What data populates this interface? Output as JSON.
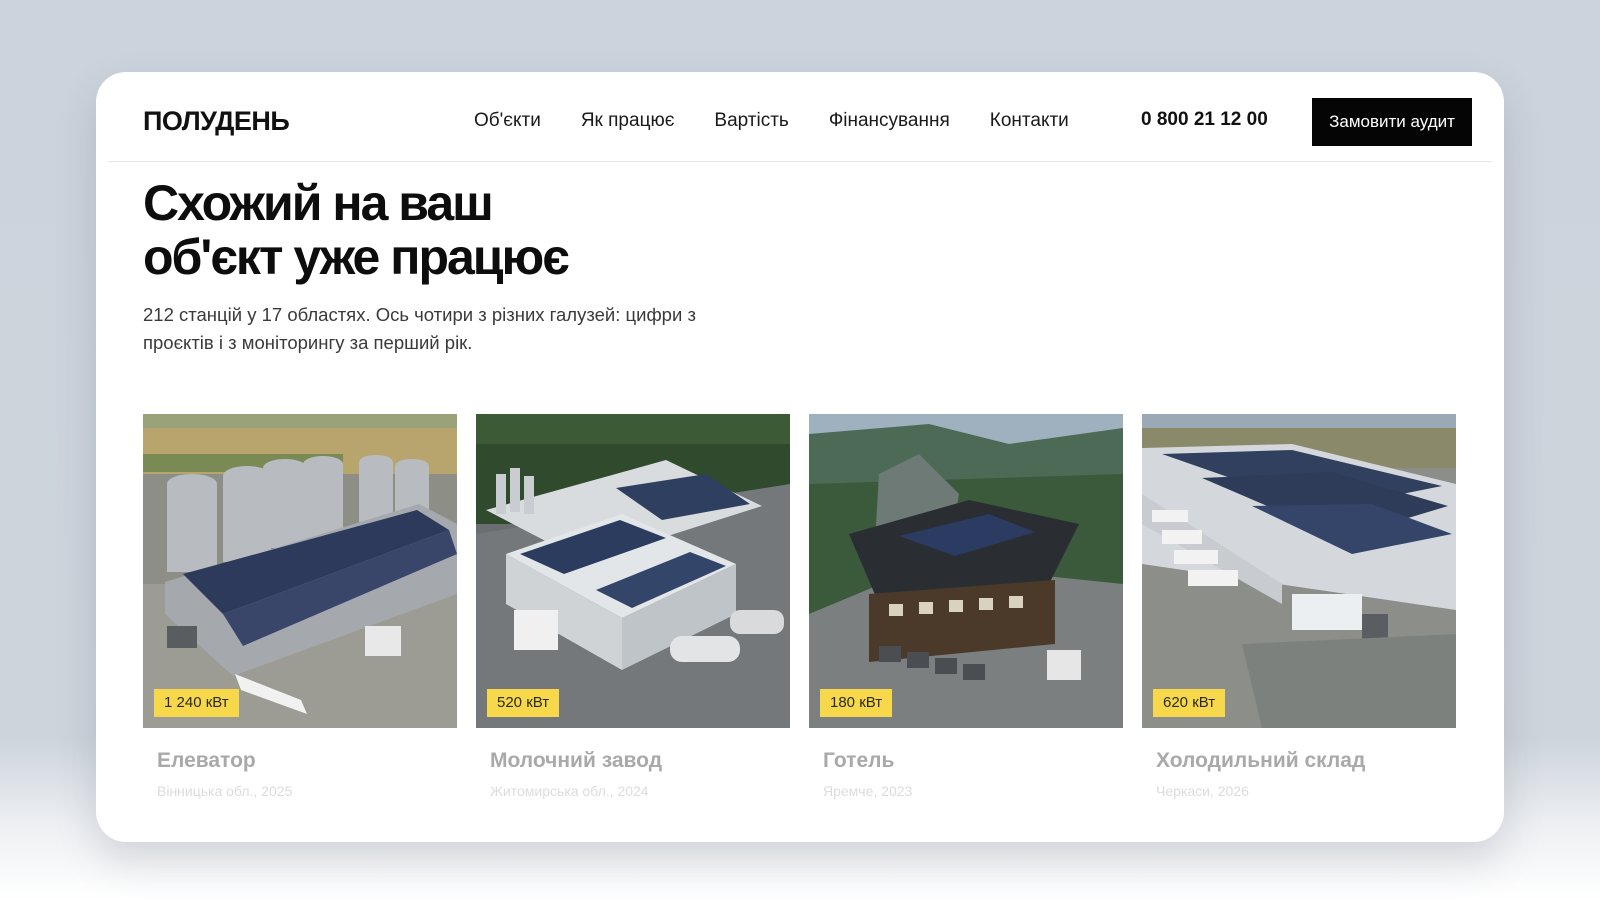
{
  "header": {
    "logo": "ПОЛУДЕНЬ",
    "nav": [
      "Об'єкти",
      "Як працює",
      "Вартість",
      "Фінансування",
      "Контакти"
    ],
    "phone": "0 800 21 12 00",
    "cta_label": "Замовити аудит"
  },
  "hero": {
    "title_line1": "Схожий на ваш",
    "title_line2": "об'єкт уже працює",
    "subtitle": "212 станцій у 17 областях. Ось чотири з різних галузей: цифри з проєктів і з моніторингу за перший рік."
  },
  "projects": [
    {
      "name": "Елеватор",
      "meta": "Вінницька обл., 2025",
      "power": "1 240 кВт",
      "photo": "grain-elevator-solar-roof-photo"
    },
    {
      "name": "Молочний завод",
      "meta": "Житомирська обл., 2024",
      "power": "520 кВт",
      "photo": "dairy-plant-solar-roof-photo"
    },
    {
      "name": "Готель",
      "meta": "Яремче, 2023",
      "power": "180 кВт",
      "photo": "mountain-hotel-solar-roof-photo"
    },
    {
      "name": "Холодильний склад",
      "meta": "Черкаси, 2026",
      "power": "620 кВт",
      "photo": "cold-storage-warehouse-solar-roof-photo"
    }
  ],
  "colors": {
    "background": "#cbd3dc",
    "cta_background": "#050505",
    "badge_background": "#f6d84a",
    "text_primary": "#0d0d0d",
    "card_title": "#a9a9a9"
  }
}
